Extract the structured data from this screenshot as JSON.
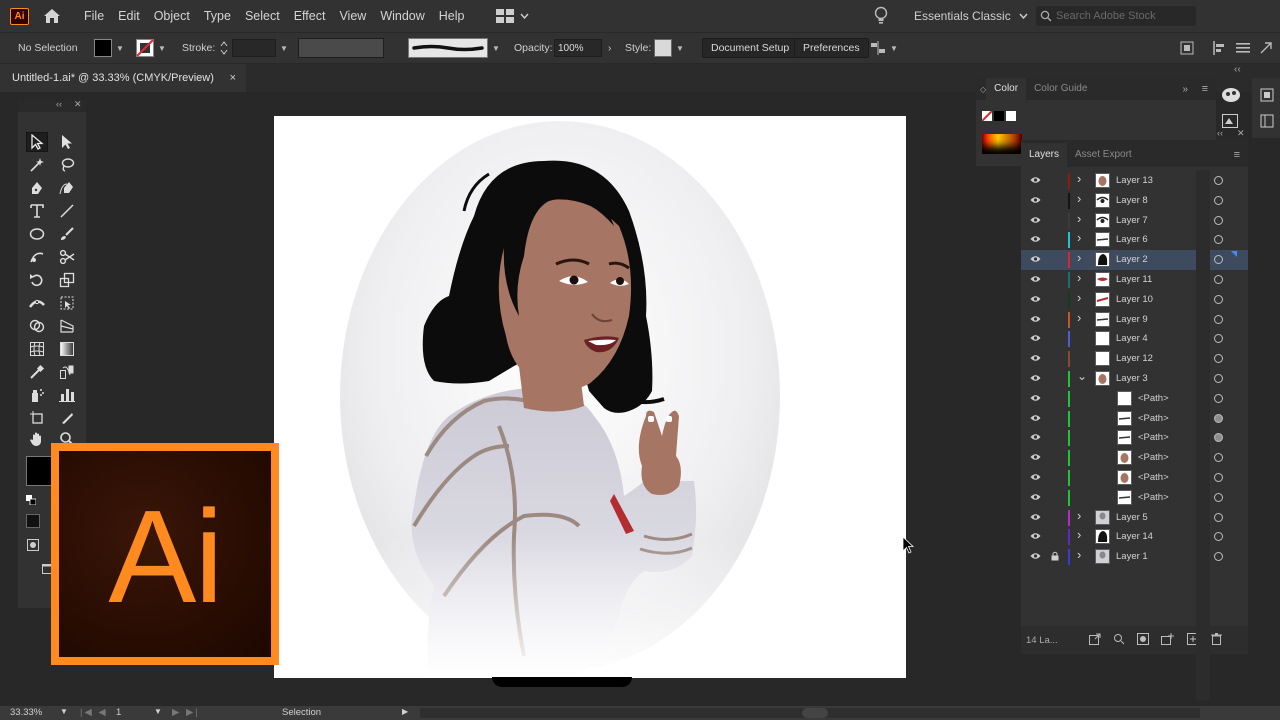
{
  "app": {
    "badge": "Ai"
  },
  "menu": [
    "File",
    "Edit",
    "Object",
    "Type",
    "Select",
    "Effect",
    "View",
    "Window",
    "Help"
  ],
  "workspace": {
    "label": "Essentials Classic"
  },
  "stock_search": {
    "placeholder": "Search Adobe Stock"
  },
  "control_bar": {
    "selection": "No Selection",
    "stroke_label": "Stroke:",
    "opacity_label": "Opacity:",
    "opacity_value": "100%",
    "style_label": "Style:",
    "document_setup": "Document Setup",
    "preferences": "Preferences"
  },
  "document_tab": {
    "title": "Untitled-1.ai* @ 33.33% (CMYK/Preview)",
    "close": "×"
  },
  "color_panel": {
    "tabs": [
      "Color",
      "Color Guide"
    ]
  },
  "layers_panel": {
    "tabs": [
      "Layers",
      "Asset Export"
    ],
    "rows": [
      {
        "name": "Layer 13",
        "color": "#8c1c0c",
        "expander": "right",
        "thumb": "skin"
      },
      {
        "name": "Layer 8",
        "color": "#141414",
        "expander": "right",
        "thumb": "eye"
      },
      {
        "name": "Layer 7",
        "color": "#3b3b3b",
        "expander": "right",
        "thumb": "eye"
      },
      {
        "name": "Layer 6",
        "color": "#22c2d8",
        "expander": "right",
        "thumb": "line"
      },
      {
        "name": "Layer 2",
        "color": "#d8262e",
        "expander": "right",
        "thumb": "hair",
        "selected": true
      },
      {
        "name": "Layer 11",
        "color": "#1f6e6c",
        "expander": "right",
        "thumb": "lips"
      },
      {
        "name": "Layer 10",
        "color": "#0f3e1c",
        "expander": "right",
        "thumb": "red-line"
      },
      {
        "name": "Layer 9",
        "color": "#c8542a",
        "expander": "right",
        "thumb": "line"
      },
      {
        "name": "Layer 4",
        "color": "#4b5ed4",
        "thumb": "blank"
      },
      {
        "name": "Layer 12",
        "color": "#8a4a2e",
        "thumb": "blank"
      },
      {
        "name": "Layer 3",
        "color": "#24c43a",
        "expander": "down",
        "thumb": "skin"
      },
      {
        "name": "<Path>",
        "color": "#24c43a",
        "sub": true,
        "thumb": "blank"
      },
      {
        "name": "<Path>",
        "color": "#24c43a",
        "sub": true,
        "thumb": "line",
        "target": "filled"
      },
      {
        "name": "<Path>",
        "color": "#24c43a",
        "sub": true,
        "thumb": "line",
        "target": "filled"
      },
      {
        "name": "<Path>",
        "color": "#24c43a",
        "sub": true,
        "thumb": "skin"
      },
      {
        "name": "<Path>",
        "color": "#24c43a",
        "sub": true,
        "thumb": "skin"
      },
      {
        "name": "<Path>",
        "color": "#24c43a",
        "sub": true,
        "thumb": "line"
      },
      {
        "name": "Layer 5",
        "color": "#b62cc2",
        "expander": "right",
        "thumb": "gray"
      },
      {
        "name": "Layer 14",
        "color": "#5a2cc2",
        "expander": "right",
        "thumb": "hair"
      },
      {
        "name": "Layer 1",
        "color": "#3b3bd4",
        "expander": "right",
        "thumb": "gray",
        "locked": true
      }
    ],
    "footer_count": "14 La..."
  },
  "ai_logo": {
    "text": "Ai"
  },
  "status_bar": {
    "zoom": "33.33%",
    "artboard": "1",
    "tool": "Selection"
  }
}
